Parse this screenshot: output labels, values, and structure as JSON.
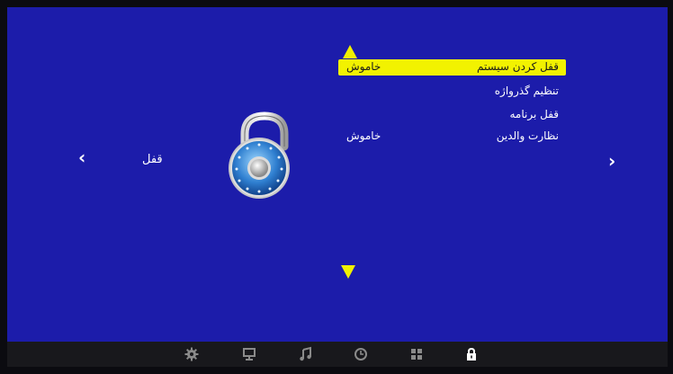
{
  "menu": {
    "title": "قفل",
    "nav_prev_glyph": "‹",
    "nav_next_glyph": "›",
    "options": [
      {
        "label": "قفل کردن سیستم",
        "value": "خاموش",
        "selected": true
      },
      {
        "label": "تنظیم گذرواژه",
        "value": ""
      },
      {
        "label": "قفل برنامه",
        "value": ""
      },
      {
        "label": "نظارت والدین",
        "value": "خاموش"
      }
    ]
  },
  "tabs": [
    {
      "icon": "gear-icon"
    },
    {
      "icon": "monitor-icon"
    },
    {
      "icon": "music-note-icon"
    },
    {
      "icon": "clock-icon"
    },
    {
      "icon": "grid-icon"
    },
    {
      "icon": "lock-icon",
      "active": true
    }
  ],
  "colors": {
    "background": "#1c1caa",
    "highlight": "#f2f200",
    "arrow": "#f0f000",
    "bar": "#18181c",
    "tab_icon": "#8a8a8a",
    "tab_icon_active": "#ffffff"
  }
}
